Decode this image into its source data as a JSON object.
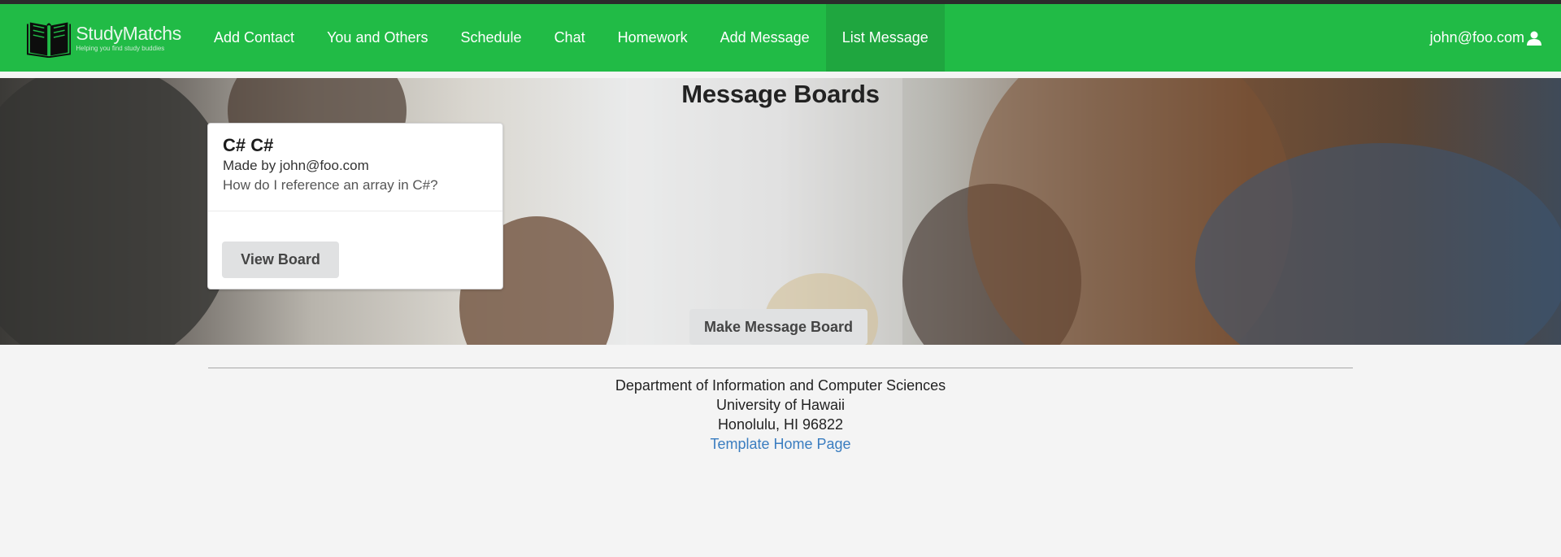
{
  "app": {
    "name": "StudyMatchs",
    "tagline": "Helping you find study buddies"
  },
  "nav": {
    "items": [
      {
        "label": "Add Contact"
      },
      {
        "label": "You and Others"
      },
      {
        "label": "Schedule"
      },
      {
        "label": "Chat"
      },
      {
        "label": "Homework"
      },
      {
        "label": "Add Message"
      },
      {
        "label": "List Message",
        "active": true
      }
    ],
    "user": "john@foo.com",
    "user_icon": "user-icon"
  },
  "page": {
    "title": "Message Boards",
    "make_button": "Make Message Board"
  },
  "boards": [
    {
      "title": "C# C#",
      "author": "Made by john@foo.com",
      "description": "How do I reference an array in C#?",
      "button": "View Board"
    }
  ],
  "footer": {
    "line1": "Department of Information and Computer Sciences",
    "line2": "University of Hawaii",
    "line3": "Honolulu, HI 96822",
    "link": "Template Home Page"
  },
  "colors": {
    "navbar": "#21bb46",
    "active_nav": "#1fa63f",
    "link": "#3a7dc0"
  }
}
